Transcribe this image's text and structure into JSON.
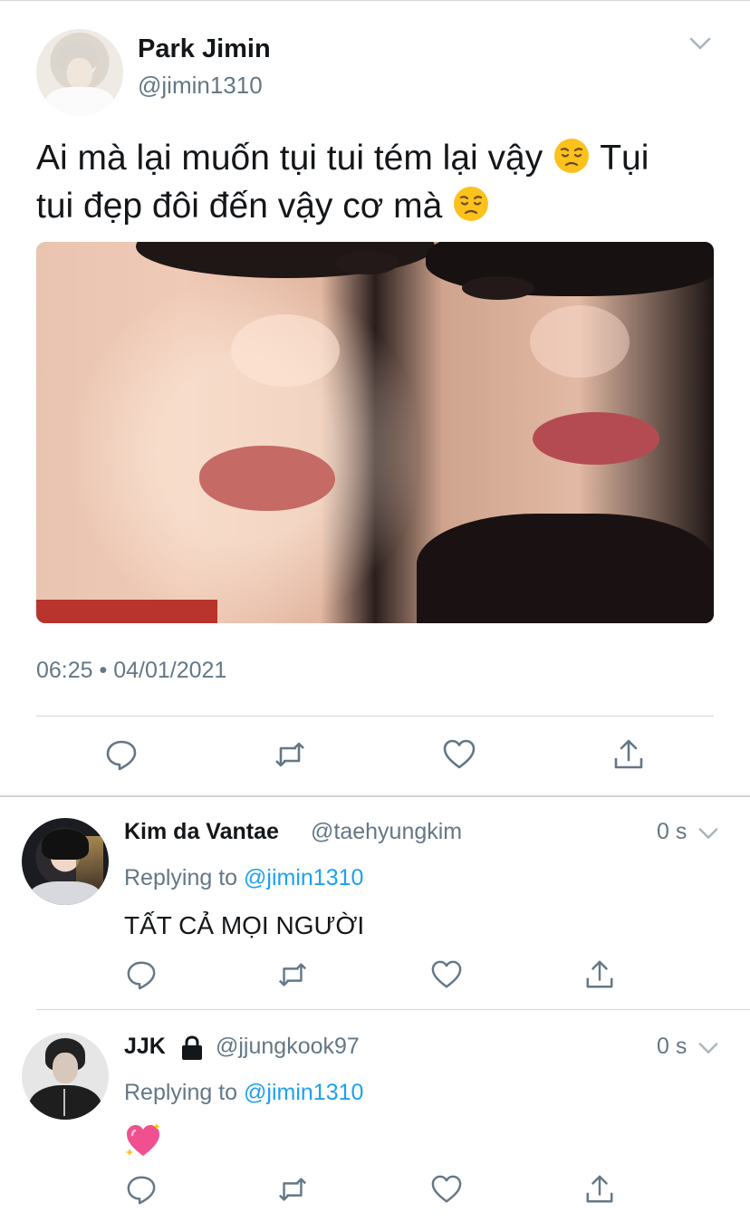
{
  "tweet": {
    "author_name": "Park Jimin",
    "author_handle": "@jimin1310",
    "text_line1": "Ai mà lại muốn tụi tui tém lại vậy",
    "text_line1_end": "Tụi",
    "text_line2": "tui đẹp đôi đến vậy cơ mà",
    "emoji": "disappointed-face-icon",
    "timestamp": "06:25 • 04/01/2021"
  },
  "replies": [
    {
      "name": "Kim da Vantae",
      "handle": "@taehyungkim",
      "time": "0 s",
      "replying_prefix": "Replying to",
      "replying_to": "@jimin1310",
      "text": "TẤT CẢ MỌI NGƯỜI"
    },
    {
      "name": "JJK",
      "handle": "@jjungkook97",
      "time": "0 s",
      "locked": true,
      "replying_prefix": "Replying to",
      "replying_to": "@jimin1310",
      "emoji": "sparkling-heart-icon"
    }
  ],
  "colors": {
    "text": "#14171a",
    "secondary": "#657786",
    "link": "#1da1f2",
    "divider": "#d3d6da"
  }
}
